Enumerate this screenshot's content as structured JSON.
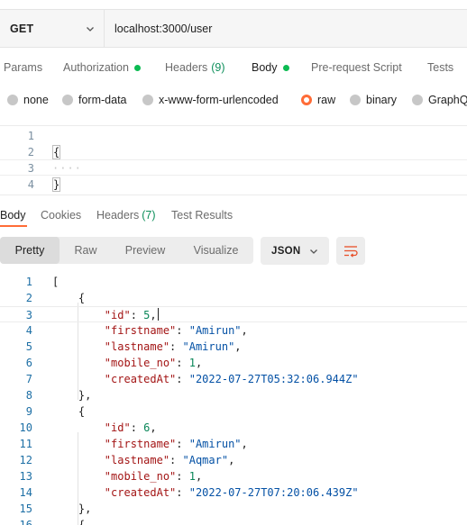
{
  "request": {
    "method": "GET",
    "url": "localhost:3000/user"
  },
  "request_tabs": [
    {
      "label": "Params"
    },
    {
      "label": "Authorization",
      "indicator": "green-dot"
    },
    {
      "label": "Headers",
      "count": "(9)"
    },
    {
      "label": "Body",
      "indicator": "green-dot",
      "active": true
    },
    {
      "label": "Pre-request Script"
    },
    {
      "label": "Tests"
    }
  ],
  "body_types": [
    {
      "label": "none",
      "selected": false
    },
    {
      "label": "form-data",
      "selected": false
    },
    {
      "label": "x-www-form-urlencoded",
      "selected": false
    },
    {
      "label": "raw",
      "selected": true
    },
    {
      "label": "binary",
      "selected": false
    },
    {
      "label": "GraphQL",
      "selected": false
    }
  ],
  "request_body": {
    "line_numbers": [
      "1",
      "2",
      "3",
      "4"
    ],
    "lines": [
      "",
      "{",
      "····",
      "}"
    ]
  },
  "response_tabs": [
    {
      "label": "Body",
      "active": true
    },
    {
      "label": "Cookies"
    },
    {
      "label": "Headers",
      "count": "(7)"
    },
    {
      "label": "Test Results"
    }
  ],
  "view_modes": [
    {
      "label": "Pretty",
      "active": true
    },
    {
      "label": "Raw"
    },
    {
      "label": "Preview"
    },
    {
      "label": "Visualize"
    }
  ],
  "format": "JSON",
  "icons": {
    "method_dropdown": "chevron-down-icon",
    "format_dropdown": "chevron-down-icon",
    "wrap": "wrap-lines-icon"
  },
  "colors": {
    "accent": "#ff6c37",
    "status_green": "#0cbb52",
    "json_key": "#a31515",
    "json_string": "#0451a5",
    "json_number": "#098658"
  },
  "response_body": {
    "line_numbers": [
      "1",
      "2",
      "3",
      "4",
      "5",
      "6",
      "7",
      "8",
      "9",
      "10",
      "11",
      "12",
      "13",
      "14",
      "15",
      "16"
    ],
    "lines": [
      "[",
      "    {",
      "        \"id\": 5,",
      "        \"firstname\": \"Amirun\",",
      "        \"lastname\": \"Amirun\",",
      "        \"mobile_no\": 1,",
      "        \"createdAt\": \"2022-07-27T05:32:06.944Z\"",
      "    },",
      "    {",
      "        \"id\": 6,",
      "        \"firstname\": \"Amirun\",",
      "        \"lastname\": \"Aqmar\",",
      "        \"mobile_no\": 1,",
      "        \"createdAt\": \"2022-07-27T07:20:06.439Z\"",
      "    },",
      "    {"
    ]
  }
}
